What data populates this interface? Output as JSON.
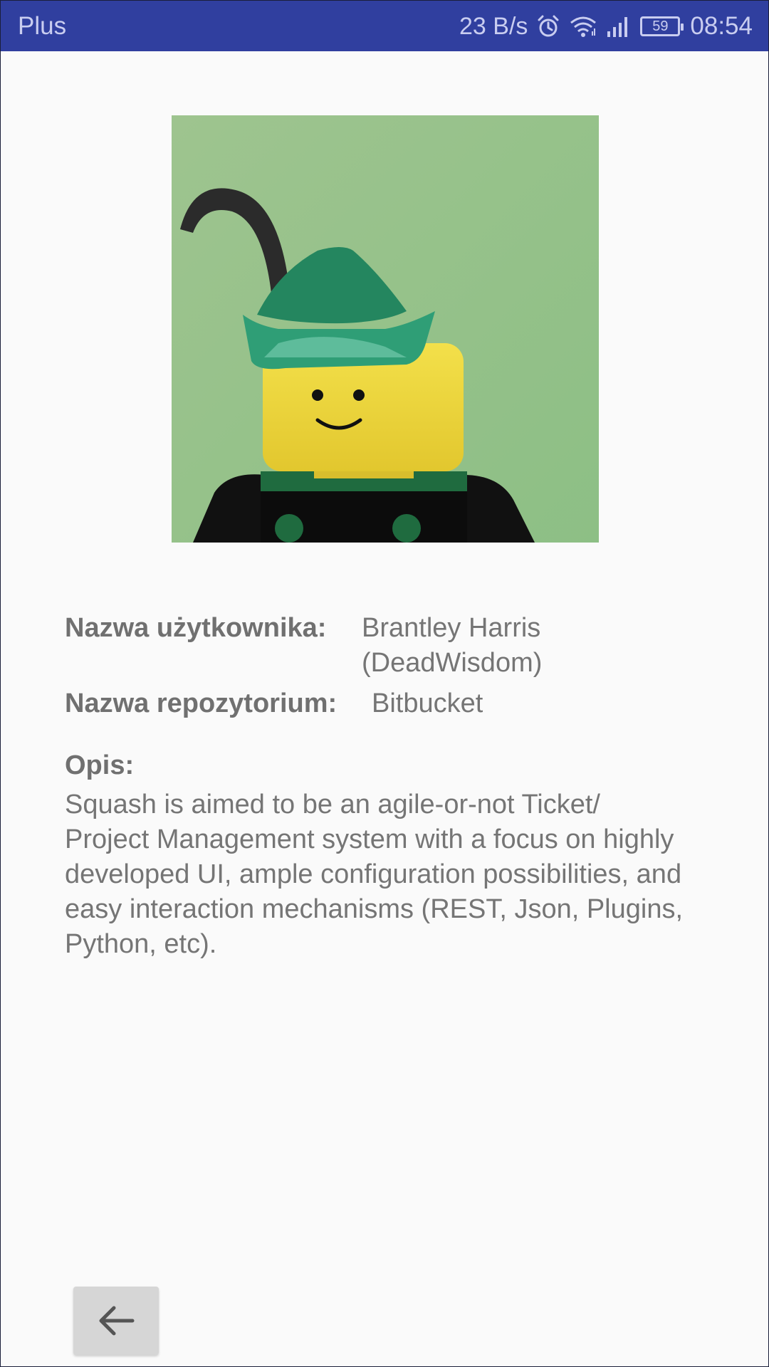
{
  "status_bar": {
    "carrier": "Plus",
    "net_speed": "23 B/s",
    "battery_level": "59",
    "time": "08:54",
    "icons": [
      "alarm-icon",
      "wifi-icon",
      "signal-icon",
      "battery-icon"
    ],
    "background_color": "#303f9f"
  },
  "profile": {
    "avatar_description_icon": "lego-minifigure-avatar",
    "user_label": "Nazwa użytkownika:",
    "user_name_line1": "Brantley Harris",
    "user_name_line2": "(DeadWisdom)",
    "repo_label": "Nazwa repozytorium:",
    "repo_name": "Bitbucket",
    "description_label": "Opis:",
    "description": "Squash is aimed to be an agile-or-not Ticket/ Project Management system with a focus on highly developed UI, ample configuration possibilities, and easy interaction mechanisms (REST, Json, Plugins, Python, etc)."
  },
  "navigation": {
    "back_icon": "arrow-left-icon"
  }
}
